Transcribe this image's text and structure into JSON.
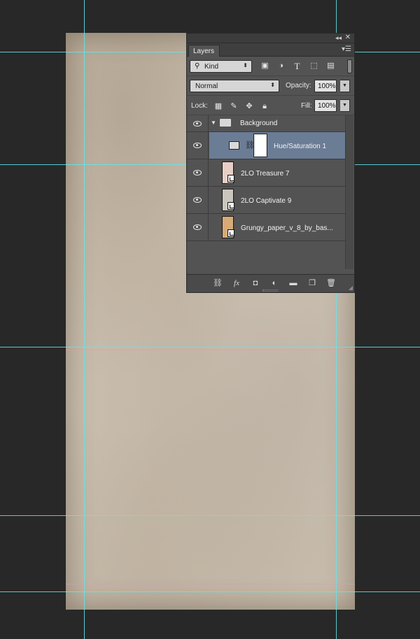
{
  "panel": {
    "tab_label": "Layers",
    "collapse_glyph": "◂◂",
    "close_glyph": "✕",
    "menu_glyph": "▾☰"
  },
  "filter": {
    "kind_label": "Kind",
    "icons": [
      "image-filter-icon",
      "adjustment-filter-icon",
      "type-filter-icon",
      "shape-filter-icon",
      "smart-object-filter-icon"
    ]
  },
  "blend": {
    "mode": "Normal",
    "opacity_label": "Opacity:",
    "opacity_value": "100%"
  },
  "lock": {
    "label": "Lock:",
    "fill_label": "Fill:",
    "fill_value": "100%"
  },
  "layers": [
    {
      "name": "Background",
      "type": "group",
      "expanded": true
    },
    {
      "name": "Hue/Saturation 1",
      "type": "adjustment",
      "selected": true
    },
    {
      "name": "2LO Treasure 7",
      "type": "smart-object",
      "thumb_color": "#e8cfc6"
    },
    {
      "name": "2LO Captivate 9",
      "type": "smart-object",
      "thumb_color": "#c9c7bd"
    },
    {
      "name": "Grungy_paper_v_8_by_bas...",
      "type": "smart-object",
      "thumb_color": "#d8aa78"
    }
  ],
  "colors": {
    "selected_row": "#6b7c95",
    "guide": "#5fe8ec",
    "panel_bg": "#535353"
  }
}
